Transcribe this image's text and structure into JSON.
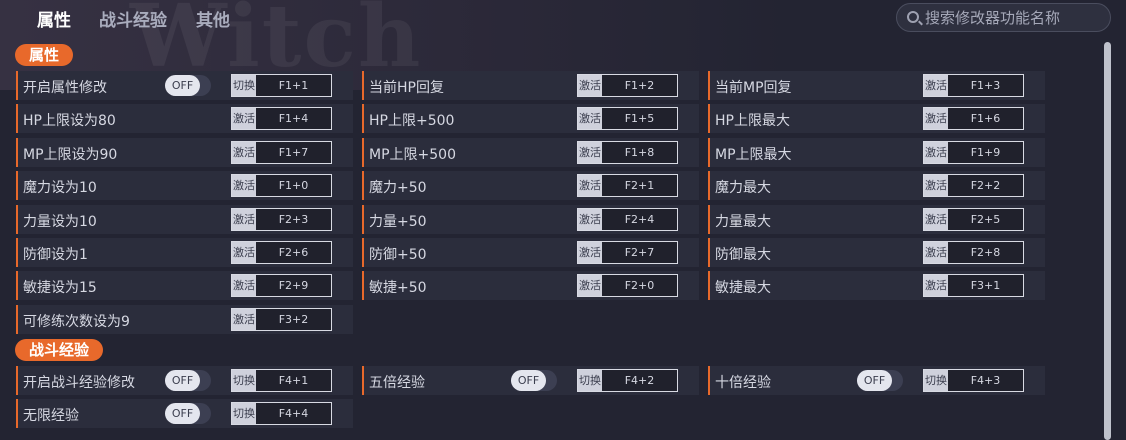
{
  "tabs": [
    "属性",
    "战斗经验",
    "其他"
  ],
  "search": {
    "placeholder": "搜索修改器功能名称"
  },
  "toggle_off": "OFF",
  "sections": [
    {
      "title": "属性",
      "rows": [
        [
          {
            "label": "开启属性修改",
            "toggle": true,
            "action": "切换",
            "hotkey": "F1+1"
          },
          {
            "label": "当前HP回复",
            "action": "激活",
            "hotkey": "F1+2"
          },
          {
            "label": "当前MP回复",
            "action": "激活",
            "hotkey": "F1+3"
          }
        ],
        [
          {
            "label": "HP上限设为80",
            "action": "激活",
            "hotkey": "F1+4"
          },
          {
            "label": "HP上限+500",
            "action": "激活",
            "hotkey": "F1+5"
          },
          {
            "label": "HP上限最大",
            "action": "激活",
            "hotkey": "F1+6"
          }
        ],
        [
          {
            "label": "MP上限设为90",
            "action": "激活",
            "hotkey": "F1+7"
          },
          {
            "label": "MP上限+500",
            "action": "激活",
            "hotkey": "F1+8"
          },
          {
            "label": "MP上限最大",
            "action": "激活",
            "hotkey": "F1+9"
          }
        ],
        [
          {
            "label": "魔力设为10",
            "action": "激活",
            "hotkey": "F1+0"
          },
          {
            "label": "魔力+50",
            "action": "激活",
            "hotkey": "F2+1"
          },
          {
            "label": "魔力最大",
            "action": "激活",
            "hotkey": "F2+2"
          }
        ],
        [
          {
            "label": "力量设为10",
            "action": "激活",
            "hotkey": "F2+3"
          },
          {
            "label": "力量+50",
            "action": "激活",
            "hotkey": "F2+4"
          },
          {
            "label": "力量最大",
            "action": "激活",
            "hotkey": "F2+5"
          }
        ],
        [
          {
            "label": "防御设为1",
            "action": "激活",
            "hotkey": "F2+6"
          },
          {
            "label": "防御+50",
            "action": "激活",
            "hotkey": "F2+7"
          },
          {
            "label": "防御最大",
            "action": "激活",
            "hotkey": "F2+8"
          }
        ],
        [
          {
            "label": "敏捷设为15",
            "action": "激活",
            "hotkey": "F2+9"
          },
          {
            "label": "敏捷+50",
            "action": "激活",
            "hotkey": "F2+0"
          },
          {
            "label": "敏捷最大",
            "action": "激活",
            "hotkey": "F3+1"
          }
        ],
        [
          {
            "label": "可修练次数设为9",
            "action": "激活",
            "hotkey": "F3+2"
          }
        ]
      ]
    },
    {
      "title": "战斗经验",
      "rows": [
        [
          {
            "label": "开启战斗经验修改",
            "toggle": true,
            "action": "切换",
            "hotkey": "F4+1"
          },
          {
            "label": "五倍经验",
            "toggle": true,
            "action": "切换",
            "hotkey": "F4+2"
          },
          {
            "label": "十倍经验",
            "toggle": true,
            "action": "切换",
            "hotkey": "F4+3"
          }
        ],
        [
          {
            "label": "无限经验",
            "toggle": true,
            "action": "切换",
            "hotkey": "F4+4"
          }
        ]
      ]
    }
  ]
}
